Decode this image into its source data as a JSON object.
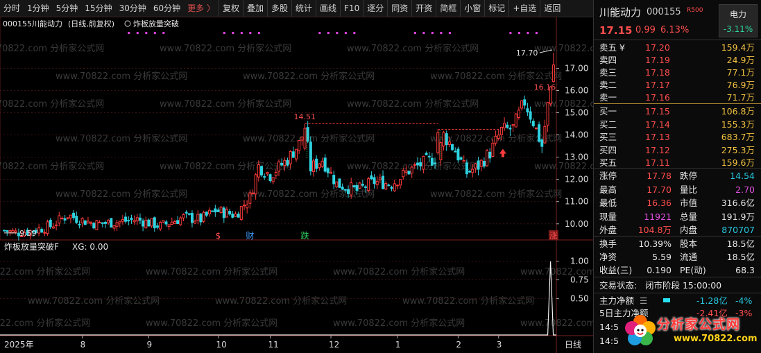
{
  "toolbar": {
    "items": [
      "分时",
      "1分钟",
      "5分钟",
      "15分钟",
      "30分钟",
      "60分钟",
      "更多 〉",
      "复权",
      "叠加",
      "多股",
      "统计",
      "画线",
      "F10",
      "逐分",
      "同资",
      "开资",
      "简框",
      "小窗",
      "标记",
      "+自选",
      "返回"
    ]
  },
  "chart_header": {
    "code": "000155",
    "name": "川能动力",
    "mode": "(日线,前复权)",
    "indicator": "炸板放量突破"
  },
  "indicator_header": {
    "name": "炸板放量突破F",
    "value": "XG: 0.00"
  },
  "period_label": "日线",
  "watermark": "www.70822.com 分析家公式网",
  "markers": [
    {
      "label": "$",
      "x_index": 74,
      "color": "#ff4d4d"
    },
    {
      "label": "财",
      "x_index": 85,
      "color": "#3fa0ff"
    },
    {
      "label": "跌",
      "x_index": 104,
      "color": "#2fd35f"
    },
    {
      "label": "涨",
      "x_index": 190,
      "color": "#ff4d4d"
    }
  ],
  "price_annotations": [
    {
      "label": "9.59",
      "x_index": 0,
      "value": 9.59
    },
    {
      "label": "14.51",
      "x_index": 104,
      "value": 14.51
    },
    {
      "label": "17.70",
      "x_index": 190,
      "value": 17.7
    },
    {
      "label": "16.16",
      "x_index": 188,
      "value": 16.16
    }
  ],
  "chart_data": [
    {
      "type": "candlestick",
      "title": "",
      "ylim": [
        9.4,
        18.2
      ],
      "y_ticks": [
        "17.00",
        "16.00",
        "15.00",
        "14.00",
        "13.00",
        "12.00",
        "11.00",
        "10.00"
      ],
      "x_tick_labels": [
        "2025年",
        "8",
        "9",
        "10",
        "11",
        "12",
        "1",
        "2",
        "3"
      ],
      "x_tick_index": [
        0,
        27,
        50,
        74,
        92,
        113,
        136,
        157,
        171
      ],
      "anchors": [
        {
          "i": 0,
          "v": 9.7
        },
        {
          "i": 4,
          "v": 9.6
        },
        {
          "i": 10,
          "v": 9.7
        },
        {
          "i": 16,
          "v": 9.9
        },
        {
          "i": 22,
          "v": 10.4
        },
        {
          "i": 26,
          "v": 10.2
        },
        {
          "i": 32,
          "v": 10.0
        },
        {
          "i": 40,
          "v": 10.1
        },
        {
          "i": 46,
          "v": 10.2
        },
        {
          "i": 54,
          "v": 9.9
        },
        {
          "i": 62,
          "v": 10.3
        },
        {
          "i": 68,
          "v": 10.2
        },
        {
          "i": 73,
          "v": 10.6
        },
        {
          "i": 80,
          "v": 10.4
        },
        {
          "i": 85,
          "v": 11.2
        },
        {
          "i": 88,
          "v": 12.6
        },
        {
          "i": 92,
          "v": 12.2
        },
        {
          "i": 98,
          "v": 12.9
        },
        {
          "i": 102,
          "v": 13.6
        },
        {
          "i": 104,
          "v": 14.3
        },
        {
          "i": 106,
          "v": 12.5
        },
        {
          "i": 110,
          "v": 12.9
        },
        {
          "i": 115,
          "v": 11.8
        },
        {
          "i": 122,
          "v": 11.5
        },
        {
          "i": 128,
          "v": 11.9
        },
        {
          "i": 134,
          "v": 11.8
        },
        {
          "i": 140,
          "v": 12.4
        },
        {
          "i": 146,
          "v": 12.8
        },
        {
          "i": 150,
          "v": 13.0
        },
        {
          "i": 152,
          "v": 14.0
        },
        {
          "i": 156,
          "v": 13.3
        },
        {
          "i": 160,
          "v": 12.3
        },
        {
          "i": 164,
          "v": 12.6
        },
        {
          "i": 168,
          "v": 13.2
        },
        {
          "i": 172,
          "v": 14.2
        },
        {
          "i": 176,
          "v": 14.3
        },
        {
          "i": 180,
          "v": 15.5
        },
        {
          "i": 183,
          "v": 14.6
        },
        {
          "i": 186,
          "v": 13.5
        },
        {
          "i": 188,
          "v": 15.3
        },
        {
          "i": 190,
          "v": 17.2
        }
      ],
      "breakout_lines": [
        {
          "from_index": 104,
          "to_index": 150,
          "value": 14.51
        },
        {
          "from_index": 150,
          "to_index": 171,
          "value": 14.25
        }
      ],
      "up_arrow": {
        "x_index": 172,
        "value": 13.0
      }
    },
    {
      "type": "line",
      "title": "",
      "ylim": [
        0,
        1.1
      ],
      "y_ticks": [
        "1.00",
        "0.75",
        "0.50"
      ],
      "series": [
        {
          "spike_index": 188,
          "value": 1.0
        }
      ]
    }
  ],
  "quote": {
    "name": "川能动力",
    "code": "000155",
    "badge": "R500",
    "sector_btn": "电力",
    "sector_change": "-3.11%",
    "price": "17.15",
    "change": "0.99",
    "change_pct": "6.13%",
    "asks": [
      {
        "label": "卖五 ¥",
        "price": "17.20",
        "vol": "159.4万"
      },
      {
        "label": "卖四",
        "price": "17.19",
        "vol": "24.9万"
      },
      {
        "label": "卖三",
        "price": "17.18",
        "vol": "77.1万"
      },
      {
        "label": "卖二",
        "price": "17.17",
        "vol": "76.9万"
      },
      {
        "label": "卖一",
        "price": "17.16",
        "vol": "71.7万"
      }
    ],
    "bids": [
      {
        "label": "买一",
        "price": "17.15",
        "vol": "106.8万"
      },
      {
        "label": "买二",
        "price": "17.14",
        "vol": "155.3万"
      },
      {
        "label": "买三",
        "price": "17.13",
        "vol": "683.7万"
      },
      {
        "label": "买四",
        "price": "17.12",
        "vol": "275.3万"
      },
      {
        "label": "买五",
        "price": "17.11",
        "vol": "159.6万"
      }
    ],
    "stats": [
      {
        "l1": "涨停",
        "v1": "17.78",
        "c1": "red",
        "l2": "跌停",
        "v2": "14.54",
        "c2": "cyan"
      },
      {
        "l1": "最高",
        "v1": "17.70",
        "c1": "red",
        "l2": "量比",
        "v2": "2.70",
        "c2": "mag"
      },
      {
        "l1": "最低",
        "v1": "16.36",
        "c1": "red",
        "l2": "市值",
        "v2": "316.6亿",
        "c2": "wht"
      },
      {
        "l1": "现量",
        "v1": "11921",
        "c1": "mag",
        "l2": "总量",
        "v2": "191.9万",
        "c2": "wht"
      },
      {
        "l1": "外盘",
        "v1": "104.8万",
        "c1": "red",
        "l2": "内盘",
        "v2": "870707",
        "c2": "cyan"
      }
    ],
    "finance": [
      {
        "l1": "换手",
        "v1": "10.39%",
        "l2": "股本",
        "v2": "18.5亿"
      },
      {
        "l1": "净资",
        "v1": "5.59",
        "l2": "流通",
        "v2": "18.5亿"
      },
      {
        "l1": "收益(三)",
        "v1": "0.190",
        "l2": "PE(动)",
        "v2": "68.3"
      }
    ],
    "status_label": "交易状态:",
    "status_value": "闭市阶段 15:00:00",
    "main_flow_label": "主力净额",
    "main_flow_value": "-1.28亿",
    "main_flow_pct": "-4%",
    "five_day_label": "5日主力净额",
    "five_day_value": "-2.41亿",
    "five_day_pct": "-3%",
    "time1": "14:5",
    "time2": "14:5"
  },
  "logo": {
    "text": "分析家公式网",
    "url": "www.70822.com"
  },
  "colors": {
    "up": "#ff3b3b",
    "down": "#2fd3e0",
    "grid": "#3a1414",
    "breakout": "#ff3b3b"
  }
}
